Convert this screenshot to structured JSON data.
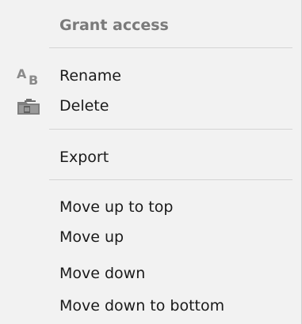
{
  "menu": {
    "grant_access": {
      "label": "Grant access",
      "enabled": false
    },
    "rename": {
      "label": "Rename",
      "icon": "rename-icon"
    },
    "delete": {
      "label": "Delete",
      "icon": "delete-icon"
    },
    "export": {
      "label": "Export"
    },
    "move_up_to_top": {
      "label": "Move up to top"
    },
    "move_up": {
      "label": "Move up"
    },
    "move_down": {
      "label": "Move down"
    },
    "move_down_to_bottom": {
      "label": "Move down to bottom"
    }
  },
  "colors": {
    "menu_background": "#f2f2f2",
    "disabled_text": "#7a7a7a",
    "text": "#1a1a1a",
    "separator": "#d4d4d4"
  }
}
